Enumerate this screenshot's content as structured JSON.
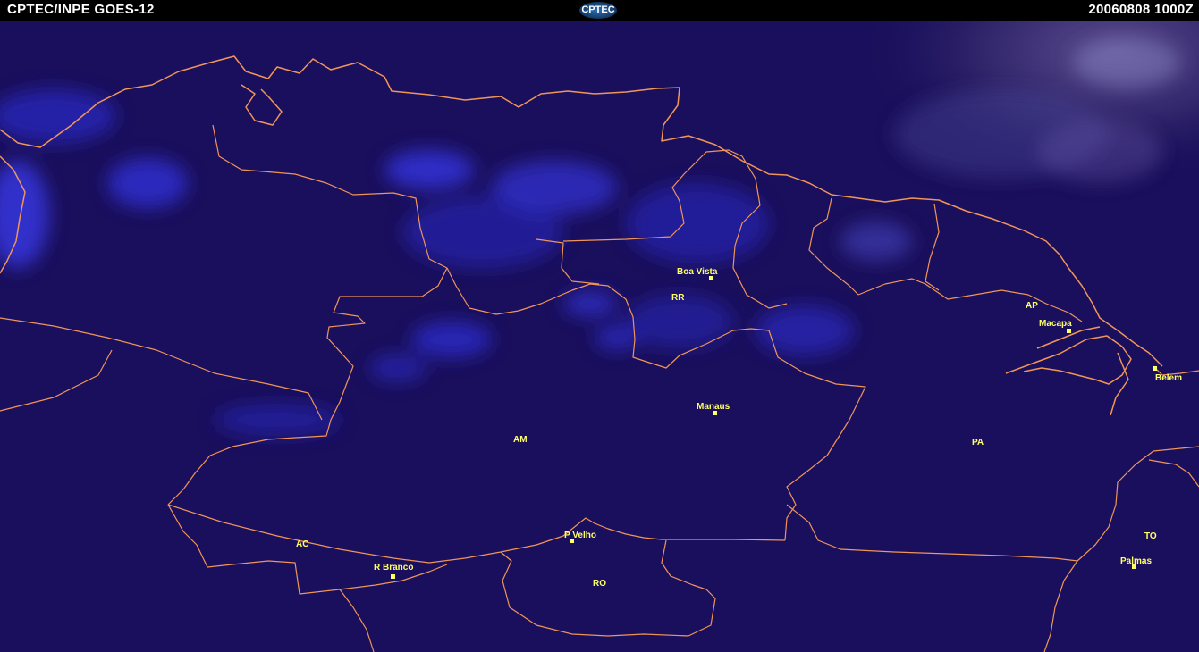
{
  "header": {
    "source": "CPTEC/INPE GOES-12",
    "logo": "CPTEC",
    "timestamp": "20060808 1000Z"
  },
  "colors": {
    "background": "#1a0f5c",
    "cloud": "#2a2ad6",
    "border": "#f0955a",
    "label": "#ffff66"
  },
  "icons": {
    "city_marker": "square-marker-icon",
    "logo": "cptec-logo-icon"
  },
  "states": [
    {
      "id": "rr",
      "label": "RR"
    },
    {
      "id": "ap",
      "label": "AP"
    },
    {
      "id": "am",
      "label": "AM"
    },
    {
      "id": "pa",
      "label": "PA"
    },
    {
      "id": "ac",
      "label": "AC"
    },
    {
      "id": "ro",
      "label": "RO"
    },
    {
      "id": "to",
      "label": "TO"
    }
  ],
  "cities": [
    {
      "id": "boa-vista",
      "label": "Boa Vista"
    },
    {
      "id": "macapa",
      "label": "Macapa"
    },
    {
      "id": "belem",
      "label": "Belem"
    },
    {
      "id": "manaus",
      "label": "Manaus"
    },
    {
      "id": "p-velho",
      "label": "P Velho"
    },
    {
      "id": "r-branco",
      "label": "R Branco"
    },
    {
      "id": "palmas",
      "label": "Palmas"
    }
  ]
}
